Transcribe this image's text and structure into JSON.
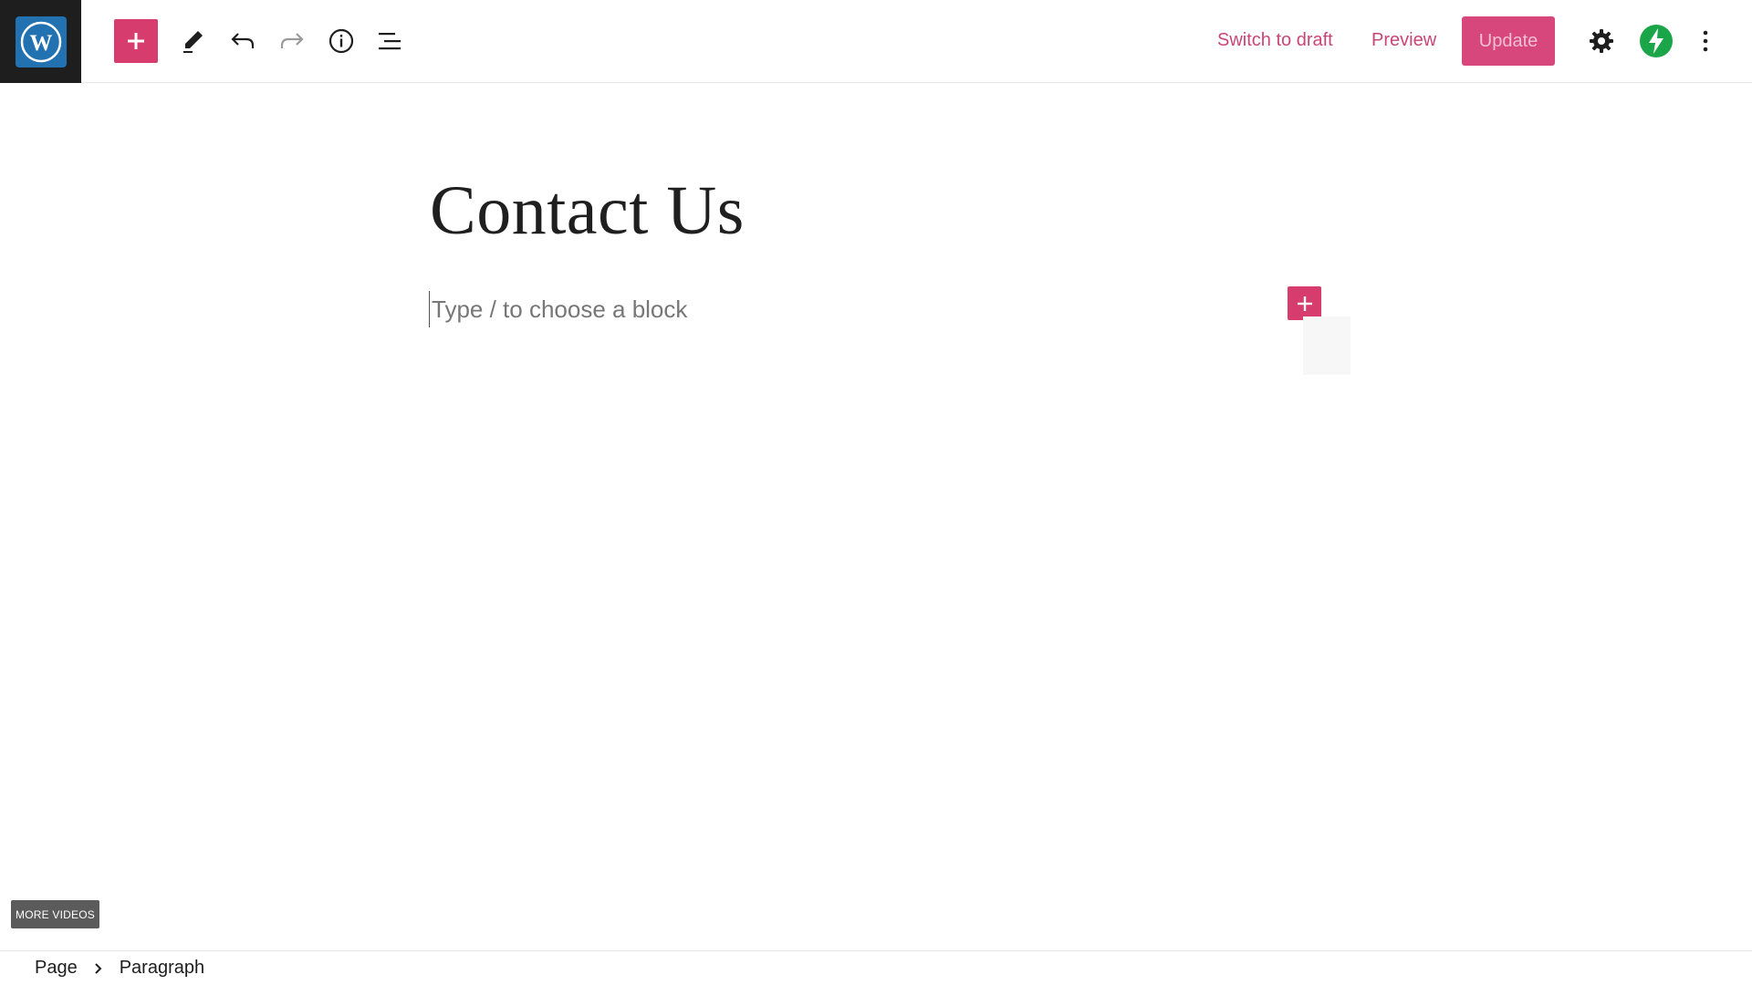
{
  "toolbar": {
    "add_block_icon": "plus-icon",
    "tools_icon": "pencil-icon",
    "undo_icon": "undo-icon",
    "redo_icon": "redo-icon",
    "details_icon": "info-icon",
    "list_view_icon": "list-view-icon",
    "switch_to_draft_label": "Switch to draft",
    "preview_label": "Preview",
    "update_label": "Update",
    "settings_icon": "gear-icon",
    "performance_icon": "lightning-icon",
    "options_icon": "more-vertical-icon"
  },
  "editor": {
    "title": "Contact Us",
    "block_placeholder": "Type / to choose a block"
  },
  "overlay": {
    "more_videos_label": "MORE VIDEOS"
  },
  "breadcrumb": {
    "items": [
      "Page",
      "Paragraph"
    ]
  },
  "colors": {
    "accent": "#d63c6e",
    "link": "#c94576",
    "logo_bg": "#1e1e1e",
    "logo_blue": "#2271b1",
    "performance_green": "#1aa648"
  }
}
